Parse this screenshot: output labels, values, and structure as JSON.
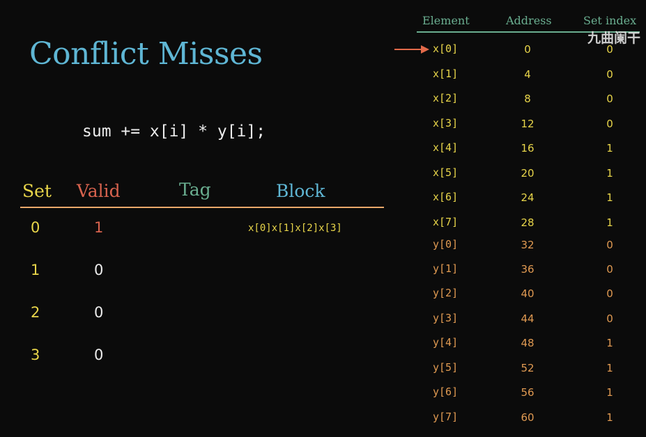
{
  "colors": {
    "title": "#5fb6d4",
    "yellow": "#e8d54a",
    "orange": "#e09a52",
    "red": "#d8634e",
    "green": "#6aae90",
    "white": "#ececec",
    "line": "#e9a86a"
  },
  "title": "Conflict Misses",
  "code": "sum += x[i] * y[i];",
  "cache": {
    "headers": {
      "set": "Set",
      "valid": "Valid",
      "tag": "Tag",
      "block": "Block"
    },
    "rows": [
      {
        "set": "0",
        "valid": "1",
        "tag": "",
        "block": "x[0]x[1]x[2]x[3]",
        "valid_color": "red"
      },
      {
        "set": "1",
        "valid": "0",
        "tag": "",
        "block": "",
        "valid_color": "white"
      },
      {
        "set": "2",
        "valid": "0",
        "tag": "",
        "block": "",
        "valid_color": "white"
      },
      {
        "set": "3",
        "valid": "0",
        "tag": "",
        "block": "",
        "valid_color": "white"
      }
    ]
  },
  "memory": {
    "headers": {
      "element": "Element",
      "address": "Address",
      "set_index": "Set index"
    },
    "rows": [
      {
        "element": "x[0]",
        "address": "0",
        "set_index": "0"
      },
      {
        "element": "x[1]",
        "address": "4",
        "set_index": "0"
      },
      {
        "element": "x[2]",
        "address": "8",
        "set_index": "0"
      },
      {
        "element": "x[3]",
        "address": "12",
        "set_index": "0"
      },
      {
        "element": "x[4]",
        "address": "16",
        "set_index": "1"
      },
      {
        "element": "x[5]",
        "address": "20",
        "set_index": "1"
      },
      {
        "element": "x[6]",
        "address": "24",
        "set_index": "1"
      },
      {
        "element": "x[7]",
        "address": "28",
        "set_index": "1"
      },
      {
        "element": "y[0]",
        "address": "32",
        "set_index": "0"
      },
      {
        "element": "y[1]",
        "address": "36",
        "set_index": "0"
      },
      {
        "element": "y[2]",
        "address": "40",
        "set_index": "0"
      },
      {
        "element": "y[3]",
        "address": "44",
        "set_index": "0"
      },
      {
        "element": "y[4]",
        "address": "48",
        "set_index": "1"
      },
      {
        "element": "y[5]",
        "address": "52",
        "set_index": "1"
      },
      {
        "element": "y[6]",
        "address": "56",
        "set_index": "1"
      },
      {
        "element": "y[7]",
        "address": "60",
        "set_index": "1"
      }
    ],
    "pointer_row": "x[0]"
  },
  "watermark": "九曲阑干"
}
